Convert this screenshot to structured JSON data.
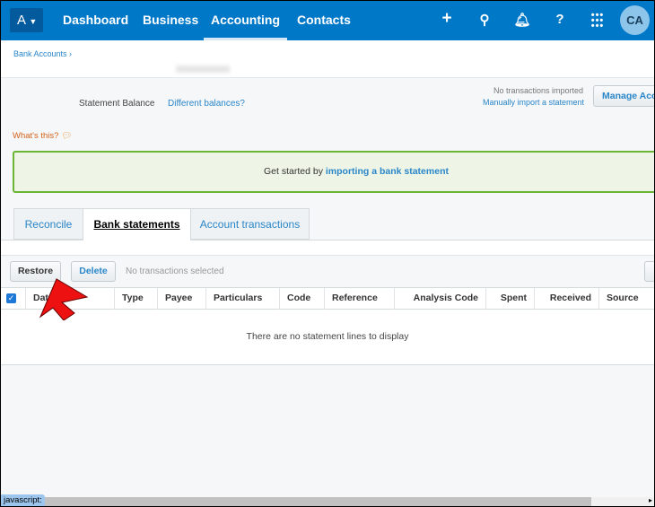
{
  "nav": {
    "org": "A",
    "items": [
      "Dashboard",
      "Business",
      "Accounting",
      "Contacts"
    ],
    "active": "Accounting",
    "avatar": "CA"
  },
  "breadcrumb": "Bank Accounts ›",
  "summary": {
    "statement_balance": "Statement Balance",
    "different_balances": "Different balances?",
    "no_transactions": "No transactions imported",
    "manual_import": "Manually import a statement",
    "manage_button": "Manage Acco"
  },
  "whats_this": "What's this?",
  "banner": {
    "prefix": "Get started by ",
    "link": "importing a bank statement"
  },
  "tabs": [
    "Reconcile",
    "Bank statements",
    "Account transactions"
  ],
  "toolbar": {
    "restore": "Restore",
    "delete": "Delete",
    "selection": "No transactions selected"
  },
  "columns": [
    "Date",
    "Type",
    "Payee",
    "Particulars",
    "Code",
    "Reference",
    "Analysis Code",
    "Spent",
    "Received",
    "Source"
  ],
  "empty_message": "There are no statement lines to display",
  "status_bar": "javascript:"
}
